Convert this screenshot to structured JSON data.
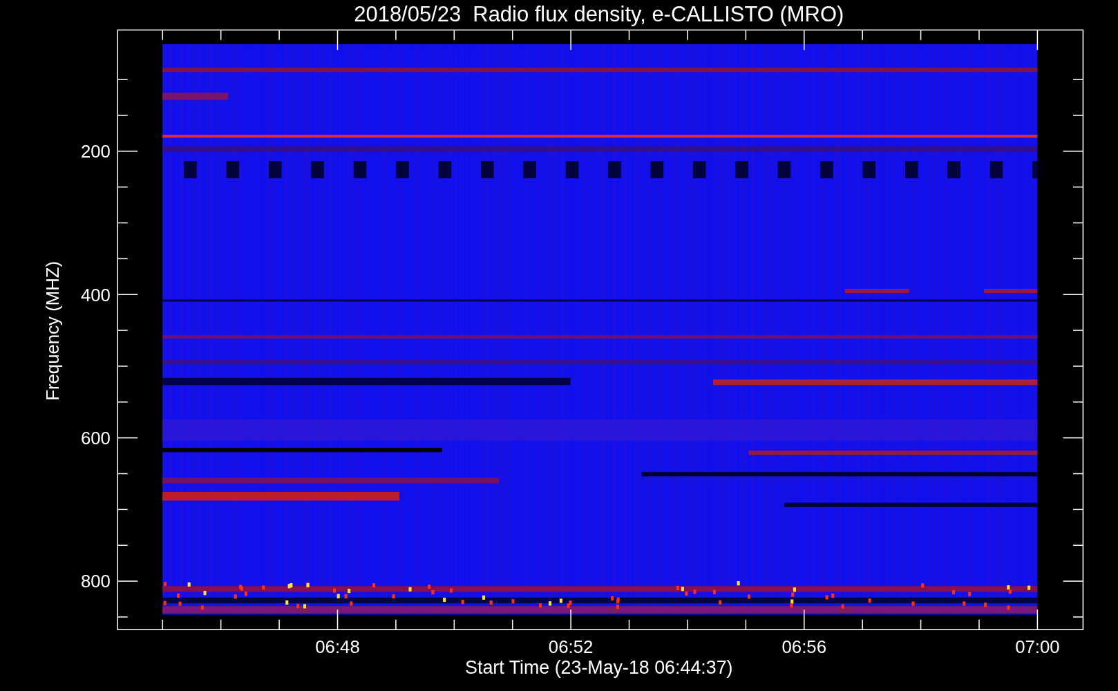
{
  "title": "2018/05/23  Radio flux density, e-CALLISTO (MRO)",
  "y_axis": {
    "label": "Frequency (MHZ)",
    "ticks": [
      "200",
      "400",
      "600",
      "800"
    ]
  },
  "x_axis": {
    "label": "Start Time (23-May-18 06:44:37)",
    "ticks": [
      "06:48",
      "06:52",
      "06:56",
      "07:00"
    ]
  }
}
